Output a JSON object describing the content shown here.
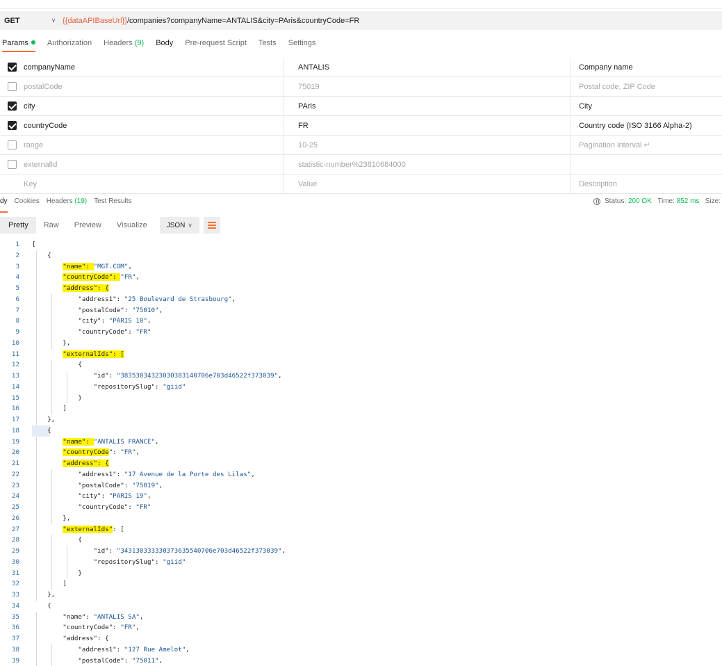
{
  "request": {
    "method": "GET",
    "url_var": "{{dataAPIBaseUrl}}",
    "url_rest": "/companies?companyName=ANTALIS&city=PAris&countryCode=FR"
  },
  "request_tabs": [
    {
      "label": "Params",
      "count": ""
    },
    {
      "label": "Authorization",
      "count": ""
    },
    {
      "label": "Headers",
      "count": "(9)"
    },
    {
      "label": "Body",
      "count": ""
    },
    {
      "label": "Pre-request Script",
      "count": ""
    },
    {
      "label": "Tests",
      "count": ""
    },
    {
      "label": "Settings",
      "count": ""
    }
  ],
  "params": [
    {
      "checked": true,
      "key": "companyName",
      "value": "ANTALIS",
      "description": "Company name"
    },
    {
      "checked": false,
      "key": "postalCode",
      "value": "75019",
      "description": "Postal code, ZIP Code"
    },
    {
      "checked": true,
      "key": "city",
      "value": "PAris",
      "description": "City"
    },
    {
      "checked": true,
      "key": "countryCode",
      "value": "FR",
      "description": "Country code (ISO 3166 Alpha-2)"
    },
    {
      "checked": false,
      "key": "range",
      "value": "10-25",
      "description": "Pagination interval ↵"
    },
    {
      "checked": false,
      "key": "externalId",
      "value": "statistic-number%23810684000",
      "description": ""
    }
  ],
  "params_placeholder": {
    "key": "Key",
    "value": "Value",
    "description": "Description"
  },
  "response_tabs": [
    {
      "label": "dy",
      "count": ""
    },
    {
      "label": "Cookies",
      "count": ""
    },
    {
      "label": "Headers",
      "count": "(19)"
    },
    {
      "label": "Test Results",
      "count": ""
    }
  ],
  "status": {
    "label": "Status:",
    "code": "200 OK",
    "time_label": "Time:",
    "time": "852 ms",
    "size_label": "Size:"
  },
  "view_modes": [
    "Pretty",
    "Raw",
    "Preview",
    "Visualize"
  ],
  "format": "JSON",
  "colors": {
    "accent": "#ff6c37",
    "green": "#0cbb52",
    "highlight": "#fff200",
    "string": "#1a5295"
  },
  "code_lines": [
    {
      "n": "1",
      "parts": [
        [
          "p",
          "["
        ]
      ]
    },
    {
      "n": "2",
      "parts": [
        [
          "p",
          "    {"
        ]
      ]
    },
    {
      "n": "3",
      "parts": [
        [
          "p",
          "        "
        ],
        [
          "h",
          "\"name\": "
        ],
        [
          "s",
          "\"MGT.COM\""
        ],
        [
          "p",
          ","
        ]
      ]
    },
    {
      "n": "4",
      "parts": [
        [
          "p",
          "        "
        ],
        [
          "h",
          "\"countryCode\": "
        ],
        [
          "s",
          "\"FR\""
        ],
        [
          "p",
          ","
        ]
      ]
    },
    {
      "n": "5",
      "parts": [
        [
          "p",
          "        "
        ],
        [
          "h",
          "\"address\": {"
        ]
      ]
    },
    {
      "n": "6",
      "parts": [
        [
          "p",
          "            \"address1\": "
        ],
        [
          "s",
          "\"25 Boulevard de Strasbourg\""
        ],
        [
          "p",
          ","
        ]
      ]
    },
    {
      "n": "7",
      "parts": [
        [
          "p",
          "            \"postalCode\": "
        ],
        [
          "s",
          "\"75010\""
        ],
        [
          "p",
          ","
        ]
      ]
    },
    {
      "n": "8",
      "parts": [
        [
          "p",
          "            \"city\": "
        ],
        [
          "s",
          "\"PARIS 10\""
        ],
        [
          "p",
          ","
        ]
      ]
    },
    {
      "n": "9",
      "parts": [
        [
          "p",
          "            \"countryCode\": "
        ],
        [
          "s",
          "\"FR\""
        ]
      ]
    },
    {
      "n": "10",
      "parts": [
        [
          "p",
          "        },"
        ]
      ]
    },
    {
      "n": "11",
      "parts": [
        [
          "p",
          "        "
        ],
        [
          "h",
          "\"externalIds\": ["
        ]
      ]
    },
    {
      "n": "12",
      "parts": [
        [
          "p",
          "            {"
        ]
      ]
    },
    {
      "n": "13",
      "parts": [
        [
          "p",
          "                \"id\": "
        ],
        [
          "s",
          "\"38353034323030383140706e703d46522f373039\""
        ],
        [
          "p",
          ","
        ]
      ]
    },
    {
      "n": "14",
      "parts": [
        [
          "p",
          "                \"repositorySlug\": "
        ],
        [
          "s",
          "\"giid\""
        ]
      ]
    },
    {
      "n": "15",
      "parts": [
        [
          "p",
          "            }"
        ]
      ]
    },
    {
      "n": "16",
      "parts": [
        [
          "p",
          "        ]"
        ]
      ]
    },
    {
      "n": "17",
      "parts": [
        [
          "p",
          "    },"
        ]
      ]
    },
    {
      "n": "18",
      "parts": [
        [
          "p",
          "    {"
        ]
      ]
    },
    {
      "n": "19",
      "parts": [
        [
          "p",
          "        "
        ],
        [
          "h",
          "\"name\": "
        ],
        [
          "s",
          "\"ANTALIS FRANCE\""
        ],
        [
          "p",
          ","
        ]
      ]
    },
    {
      "n": "20",
      "parts": [
        [
          "p",
          "        "
        ],
        [
          "h",
          "\"countryCode"
        ],
        [
          "p",
          "\": "
        ],
        [
          "s",
          "\"FR\""
        ],
        [
          "p",
          ","
        ]
      ]
    },
    {
      "n": "21",
      "parts": [
        [
          "p",
          "        "
        ],
        [
          "h",
          "\"address\": {"
        ]
      ]
    },
    {
      "n": "22",
      "parts": [
        [
          "p",
          "            \"address1\": "
        ],
        [
          "s",
          "\"17 Avenue de la Porte des Lilas\""
        ],
        [
          "p",
          ","
        ]
      ]
    },
    {
      "n": "23",
      "parts": [
        [
          "p",
          "            \"postalCode\": "
        ],
        [
          "s",
          "\"75019\""
        ],
        [
          "p",
          ","
        ]
      ]
    },
    {
      "n": "24",
      "parts": [
        [
          "p",
          "            \"city\": "
        ],
        [
          "s",
          "\"PARIS 19\""
        ],
        [
          "p",
          ","
        ]
      ]
    },
    {
      "n": "25",
      "parts": [
        [
          "p",
          "            \"countryCode\": "
        ],
        [
          "s",
          "\"FR\""
        ]
      ]
    },
    {
      "n": "26",
      "parts": [
        [
          "p",
          "        },"
        ]
      ]
    },
    {
      "n": "27",
      "parts": [
        [
          "p",
          "        "
        ],
        [
          "h",
          "\"externalIds\""
        ],
        [
          "p",
          ": ["
        ]
      ]
    },
    {
      "n": "28",
      "parts": [
        [
          "p",
          "            {"
        ]
      ]
    },
    {
      "n": "29",
      "parts": [
        [
          "p",
          "                \"id\": "
        ],
        [
          "s",
          "\"343130333330373635540706e703d46522f373039\""
        ],
        [
          "p",
          ","
        ]
      ]
    },
    {
      "n": "30",
      "parts": [
        [
          "p",
          "                \"repositorySlug\": "
        ],
        [
          "s",
          "\"giid\""
        ]
      ]
    },
    {
      "n": "31",
      "parts": [
        [
          "p",
          "            }"
        ]
      ]
    },
    {
      "n": "32",
      "parts": [
        [
          "p",
          "        ]"
        ]
      ]
    },
    {
      "n": "33",
      "parts": [
        [
          "p",
          "    },"
        ]
      ]
    },
    {
      "n": "34",
      "parts": [
        [
          "p",
          "    {"
        ]
      ]
    },
    {
      "n": "35",
      "parts": [
        [
          "p",
          "        \"name\": "
        ],
        [
          "s",
          "\"ANTALIS SA\""
        ],
        [
          "p",
          ","
        ]
      ]
    },
    {
      "n": "36",
      "parts": [
        [
          "p",
          "        \"countryCode\": "
        ],
        [
          "s",
          "\"FR\""
        ],
        [
          "p",
          ","
        ]
      ]
    },
    {
      "n": "37",
      "parts": [
        [
          "p",
          "        \"address\": {"
        ]
      ]
    },
    {
      "n": "38",
      "parts": [
        [
          "p",
          "            \"address1\": "
        ],
        [
          "s",
          "\"127 Rue Amelot\""
        ],
        [
          "p",
          ","
        ]
      ]
    },
    {
      "n": "39",
      "parts": [
        [
          "p",
          "            \"postalCode\": "
        ],
        [
          "s",
          "\"75011\""
        ],
        [
          "p",
          ","
        ]
      ]
    }
  ]
}
